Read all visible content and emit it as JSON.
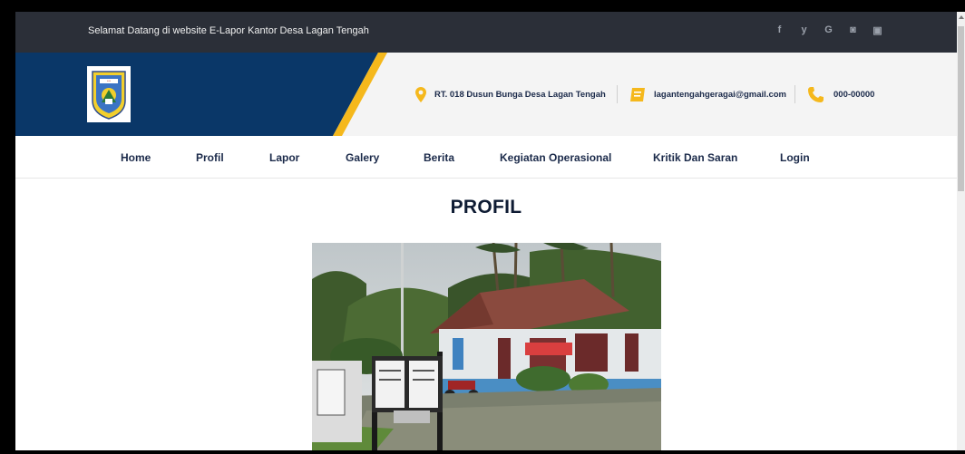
{
  "topbar": {
    "welcome": "Selamat Datang di website E-Lapor Kantor Desa Lagan Tengah",
    "social": [
      {
        "glyph": "f",
        "icon": "facebook-icon"
      },
      {
        "glyph": "y",
        "icon": "twitter-icon"
      },
      {
        "glyph": "G",
        "icon": "google-icon"
      },
      {
        "glyph": "◙",
        "icon": "instagram-icon"
      },
      {
        "glyph": "▣",
        "icon": "youtube-icon"
      }
    ]
  },
  "header": {
    "address": "RT. 018 Dusun Bunga Desa Lagan Tengah",
    "email": "lagantengahgeragai@gmail.com",
    "phone": "000-00000"
  },
  "nav": {
    "items": [
      "Home",
      "Profil",
      "Lapor",
      "Galery",
      "Berita",
      "Kegiatan Operasional",
      "Kritik Dan Saran",
      "Login"
    ]
  },
  "main": {
    "title": "PROFIL"
  },
  "colors": {
    "navy": "#0a3768",
    "accent": "#f5b81c",
    "topbar": "#2b2f38",
    "text": "#1b2a4a"
  }
}
